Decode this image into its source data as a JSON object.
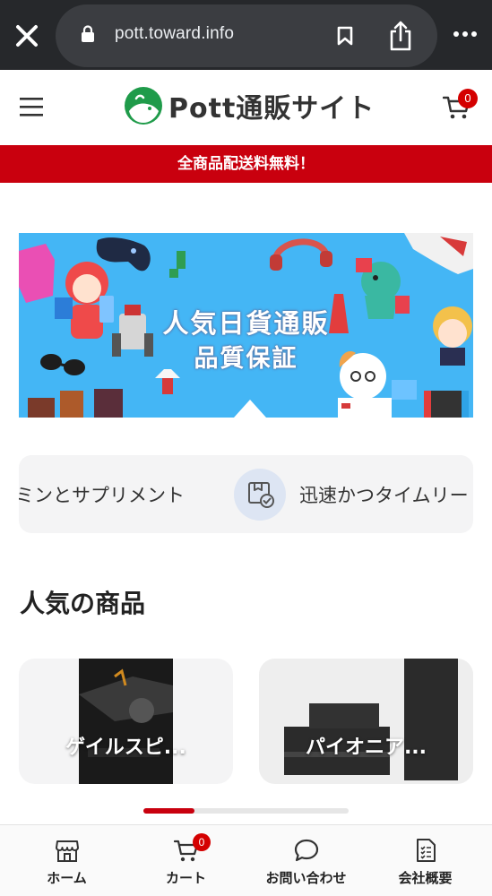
{
  "browser": {
    "url": "pott.toward.info",
    "icons": [
      "close-icon",
      "lock-icon",
      "bookmark-icon",
      "share-icon",
      "more-icon"
    ]
  },
  "header": {
    "logo_text": "Pott通販サイト",
    "cart_count": "0",
    "icons": [
      "menu-icon",
      "logo-icon",
      "cart-icon"
    ]
  },
  "announcement": "全商品配送料無料！",
  "hero": {
    "line1": "人気日貨通販",
    "line2": "品質保証"
  },
  "features": [
    {
      "label": "ミンとサプリメント"
    },
    {
      "label": "迅速かつタイムリー",
      "icon": "package-check-icon"
    }
  ],
  "popular": {
    "title": "人気の商品",
    "products": [
      {
        "name": "ゲイルスピ..."
      },
      {
        "name": "パイオニア..."
      }
    ],
    "scroll_progress": 0.25
  },
  "bottom_nav": [
    {
      "label": "ホーム",
      "icon": "store-icon"
    },
    {
      "label": "カート",
      "icon": "cart-icon",
      "badge": "0"
    },
    {
      "label": "お問い合わせ",
      "icon": "chat-icon"
    },
    {
      "label": "会社概要",
      "icon": "document-icon"
    }
  ],
  "colors": {
    "brand_red": "#c9000e",
    "browser_bg": "#26282b",
    "hero_bg": "#44b6f5"
  }
}
